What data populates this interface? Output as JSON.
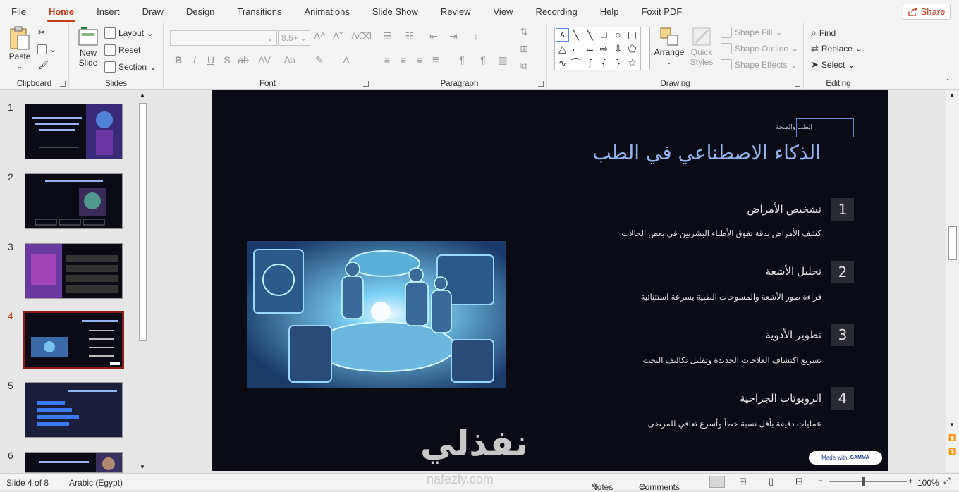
{
  "menu": {
    "tabs": [
      "File",
      "Home",
      "Insert",
      "Draw",
      "Design",
      "Transitions",
      "Animations",
      "Slide Show",
      "Review",
      "View",
      "Recording",
      "Help",
      "Foxit PDF"
    ],
    "share_label": "Share"
  },
  "ribbon": {
    "clipboard": {
      "label": "Clipboard",
      "paste": "Paste"
    },
    "slides": {
      "label": "Slides",
      "new_slide": "New Slide",
      "layout": "Layout",
      "reset": "Reset",
      "section": "Section"
    },
    "font": {
      "label": "Font",
      "size_placeholder": "8.5+"
    },
    "paragraph": {
      "label": "Paragraph"
    },
    "drawing": {
      "label": "Drawing",
      "arrange": "Arrange",
      "quick_styles": "Quick Styles",
      "shape_fill": "Shape Fill",
      "shape_outline": "Shape Outline",
      "shape_effects": "Shape Effects"
    },
    "editing": {
      "label": "Editing",
      "find": "Find",
      "replace": "Replace",
      "select": "Select"
    }
  },
  "thumbnails": {
    "numbers": [
      "1",
      "2",
      "3",
      "4",
      "5",
      "6"
    ],
    "selected": "4"
  },
  "slide": {
    "tag": "الطب والصحة",
    "title": "الذكاء الاصطناعي في الطب",
    "items": [
      {
        "num": "1",
        "title": "تشخيص الأمراض",
        "desc": "كشف الأمراض بدقة تفوق الأطباء البشريين في بعض الحالات"
      },
      {
        "num": "2",
        "title": "تحليل الأشعة",
        "desc": "قراءة صور الأشعة والمسوحات الطبية بسرعة استثنائية"
      },
      {
        "num": "3",
        "title": "تطوير الأدوية",
        "desc": "تسريع اكتشاف العلاجات الجديدة وتقليل تكاليف البحث"
      },
      {
        "num": "4",
        "title": "الروبوتات الجراحية",
        "desc": "عمليات دقيقة بأقل نسبة خطأ وأسرع تعافي للمرضى"
      }
    ],
    "badge_prefix": "Made with",
    "badge_brand": "GAMMA",
    "watermark": "نفذلي",
    "watermark_sub": "nafezly.com"
  },
  "status": {
    "slide_info": "Slide 4 of 8",
    "language": "Arabic (Egypt)",
    "notes": "Notes",
    "comments": "Comments",
    "zoom": "100%"
  },
  "colors": {
    "accent": "#c43e1c",
    "slide_bg": "#0a0b14",
    "title": "#8fb4f0"
  }
}
